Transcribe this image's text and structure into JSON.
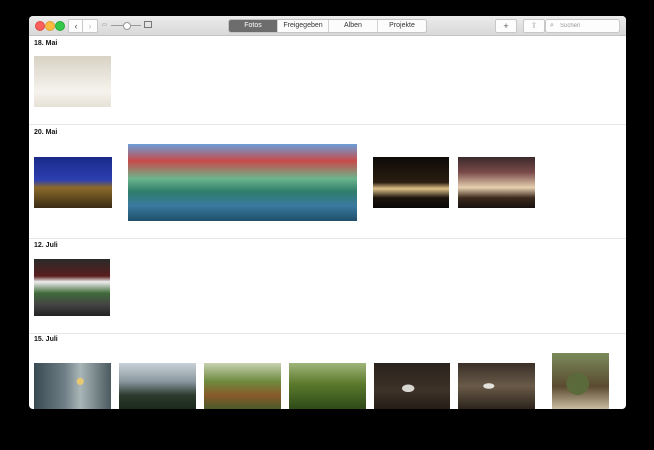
{
  "toolbar": {
    "back_icon": "‹",
    "forward_icon": "›",
    "zoom_small_icon": "▭",
    "tabs": [
      {
        "label": "Fotos",
        "active": true
      },
      {
        "label": "Freigegeben",
        "active": false
      },
      {
        "label": "Alben",
        "active": false
      },
      {
        "label": "Projekte",
        "active": false
      }
    ],
    "add_label": "+",
    "share_icon": "⇪",
    "search_icon": "⌕",
    "search_placeholder": "Suchen"
  },
  "moments": [
    {
      "title": "18. Mai",
      "photos": [
        "bedroom"
      ]
    },
    {
      "title": "20. Mai",
      "photos": [
        "brandenburg-gate",
        "riverside-cafe",
        "night-street",
        "night-building"
      ]
    },
    {
      "title": "12. Juli",
      "photos": [
        "green-sign"
      ]
    },
    {
      "title": "15. Juli",
      "photos": [
        "hanging-lights",
        "glass-roof",
        "palm-trunk",
        "fern",
        "bird-ground",
        "bird-stones",
        "cactus-pot"
      ]
    }
  ]
}
